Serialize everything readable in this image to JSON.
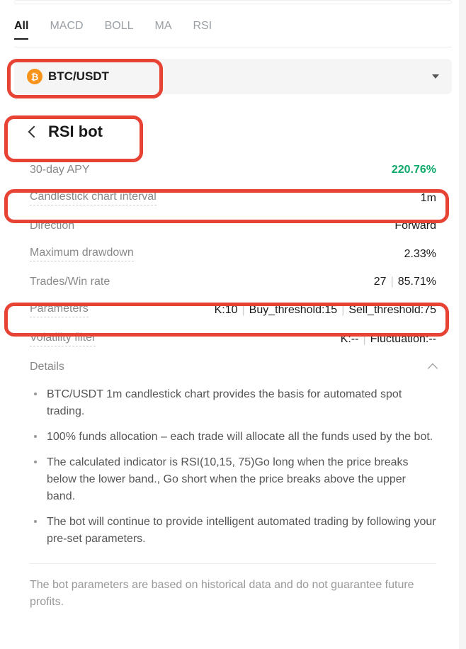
{
  "tabs": {
    "all": "All",
    "macd": "MACD",
    "boll": "BOLL",
    "ma": "MA",
    "rsi": "RSI"
  },
  "pair": "BTC/USDT",
  "btc_symbol": "₿",
  "bot_title": "RSI bot",
  "stats": {
    "apy_label": "30-day APY",
    "apy_value": "220.76%",
    "interval_label": "Candlestick chart interval",
    "interval_value": "1m",
    "direction_label": "Direction",
    "direction_value": "Forward",
    "drawdown_label": "Maximum drawdown",
    "drawdown_value": "2.33%",
    "trades_label": "Trades/Win rate",
    "trades_count": "27",
    "trades_winrate": "85.71%",
    "params_label": "Parameters",
    "params_k": "K:10",
    "params_buy": "Buy_threshold:15",
    "params_sell": "Sell_threshold:75",
    "volfilter_label": "Volatility filter",
    "volfilter_k": "K:--",
    "volfilter_fluct": "Fluctuation:--"
  },
  "details_label": "Details",
  "details": {
    "item0": "BTC/USDT 1m candlestick chart provides the basis for automated spot trading.",
    "item1": "100% funds allocation – each trade will allocate all the funds used by the bot.",
    "item2": "The calculated indicator is RSI(10,15, 75)Go long when the price breaks below the lower band., Go short when the price breaks above the upper band.",
    "item3": "The bot will continue to provide intelligent automated trading by following your pre-set parameters."
  },
  "disclaimer": "The bot parameters are based on historical data and do not guarantee future profits."
}
